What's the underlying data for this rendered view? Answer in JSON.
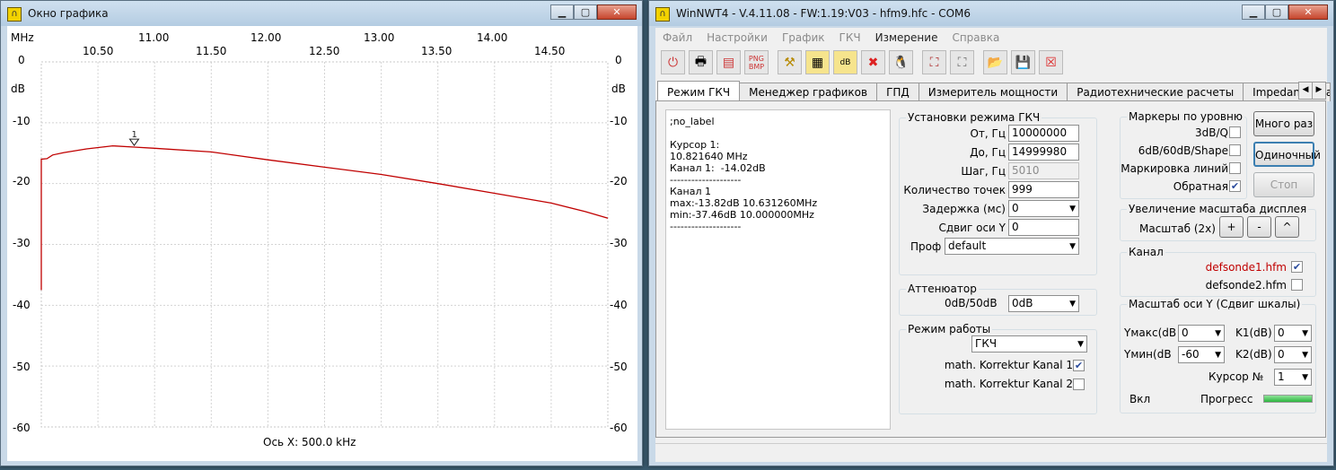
{
  "graph_window": {
    "title": "Окно графика",
    "x_unit": "MHz",
    "x_ticks_top": [
      "11.00",
      "12.00",
      "13.00",
      "14.00"
    ],
    "x_ticks_bottom": [
      "10.50",
      "11.50",
      "12.50",
      "13.50",
      "14.50"
    ],
    "y_unit": "dB",
    "y_ticks": [
      "0",
      "-10",
      "-20",
      "-30",
      "-40",
      "-50",
      "-60"
    ],
    "x_scale_label": "Ось X: 500.0 kHz",
    "marker_label": "1",
    "trace_color": "#c00000"
  },
  "chart_data": {
    "type": "line",
    "x_range_mhz": [
      10.0,
      15.0
    ],
    "y_range_db": [
      -60,
      0
    ],
    "series": [
      {
        "name": "Канал 1",
        "points": [
          [
            10.0,
            -37.5
          ],
          [
            10.0,
            -16.0
          ],
          [
            10.05,
            -15.9
          ],
          [
            10.1,
            -15.3
          ],
          [
            10.2,
            -14.9
          ],
          [
            10.4,
            -14.3
          ],
          [
            10.63,
            -13.8
          ],
          [
            10.82,
            -14.0
          ],
          [
            11.0,
            -14.2
          ],
          [
            11.5,
            -14.8
          ],
          [
            12.0,
            -16.1
          ],
          [
            12.5,
            -17.3
          ],
          [
            13.0,
            -18.5
          ],
          [
            13.5,
            -20.0
          ],
          [
            14.0,
            -21.6
          ],
          [
            14.5,
            -23.2
          ],
          [
            14.8,
            -24.6
          ],
          [
            15.0,
            -25.7
          ]
        ]
      }
    ],
    "marker": {
      "label": "1",
      "x": 10.82,
      "y": -14.02
    }
  },
  "app_window": {
    "title": "WinNWT4 - V.4.11.08 - FW:1.19:V03 - hfm9.hfc - COM6",
    "menu": [
      "Файл",
      "Настройки",
      "График",
      "ГКЧ",
      "Измерение",
      "Справка"
    ],
    "toolbar_icons": [
      "power-icon",
      "printer-icon",
      "print-preview-icon",
      "png-bmp-icon",
      "tools-icon",
      "chart-icon",
      "dB-chart-icon",
      "wrench-icon",
      "tux-icon",
      "calibrate-icon",
      "calibrate2-icon",
      "open-folder-icon",
      "save-icon",
      "delete-icon"
    ],
    "tabs": [
      "Режим ГКЧ",
      "Менеджер графиков",
      "ГПД",
      "Измеритель мощности",
      "Радиотехнические расчеты",
      "Impedanzanpass"
    ],
    "info_text": ";no_label\n\nКурсор 1:\n10.821640 MHz\nКанал 1:  -14.02dB\n--------------------\nКанал 1\nmax:-13.82dB 10.631260MHz\nmin:-37.46dB 10.000000MHz\n--------------------",
    "sweep": {
      "title": "Установки режима ГКЧ",
      "from_label": "От, Гц",
      "from_value": "10000000",
      "to_label": "До, Гц",
      "to_value": "14999980",
      "step_label": "Шаг, Гц",
      "step_value": "5010",
      "points_label": "Количество точек",
      "points_value": "999",
      "delay_label": "Задержка (мс)",
      "delay_value": "0",
      "yshift_label": "Сдвиг оси Y",
      "yshift_value": "0",
      "profile_label": "Проф",
      "profile_value": "default"
    },
    "attenuator": {
      "title": "Аттенюатор",
      "label": "0dB/50dB",
      "value": "0dB"
    },
    "mode": {
      "title": "Режим работы",
      "value": "ГКЧ",
      "corr1_label": "math. Korrektur Kanal 1",
      "corr2_label": "math. Korrektur Kanal 2"
    },
    "markers": {
      "title": "Маркеры по уровню",
      "m1": "3dB/Q",
      "m2": "6dB/60dB/Shape",
      "m3": "Маркировка линий",
      "m4": "Обратная"
    },
    "buttons": {
      "many": "Много раз",
      "single": "Одиночный",
      "stop": "Стоп"
    },
    "zoom": {
      "title": "Увеличение масштаба дисплея",
      "label": "Масштаб (2x)",
      "plus": "+",
      "minus": "-",
      "up": "^"
    },
    "channel": {
      "title": "Канал",
      "file1": "defsonde1.hfm",
      "file2": "defsonde2.hfm",
      "file1_color": "#c00000"
    },
    "yscale": {
      "title": "Масштаб оси Y (Сдвиг шкалы)",
      "ymax_label": "Yмакс(dB",
      "ymax_value": "0",
      "ymin_label": "Yмин(dB",
      "ymin_value": "-60",
      "k1_label": "K1(dB)",
      "k1_value": "0",
      "k2_label": "K2(dB)",
      "k2_value": "0",
      "cursor_label": "Курсор №",
      "cursor_value": "1",
      "on_label": "Вкл",
      "progress_label": "Прогресс",
      "progress_fraction": 1.0
    }
  }
}
